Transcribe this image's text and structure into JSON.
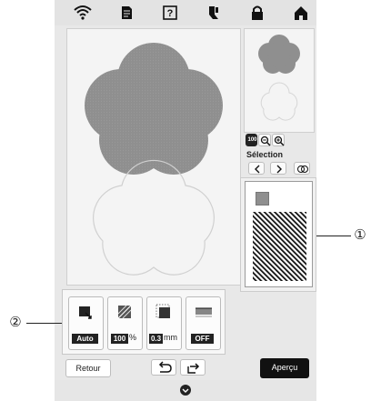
{
  "callouts": {
    "one": "①",
    "two": "②"
  },
  "selection_label": "Sélection",
  "zoom_badge": "100",
  "tools": {
    "auto_value": "Auto",
    "density_value": "100",
    "density_unit": "%",
    "distance_value": "0.3",
    "distance_unit": "mm",
    "underlay_value": "OFF"
  },
  "buttons": {
    "back": "Retour",
    "preview": "Aperçu"
  },
  "icons": {
    "status": [
      "wifi-icon",
      "document-icon",
      "help-icon",
      "thread-icon",
      "lock-icon",
      "home-icon"
    ],
    "zoom": [
      "zoom-out-icon",
      "zoom-in-icon"
    ],
    "nav": [
      "arrow-left-icon",
      "arrow-right-icon",
      "multi-select-icon"
    ],
    "bottom": [
      "undo-icon",
      "redo-icon",
      "settings-icon"
    ]
  },
  "colors": {
    "shape_fill": "#8f8f8f",
    "outline": "#cfcfcf",
    "accent": "#222222"
  }
}
